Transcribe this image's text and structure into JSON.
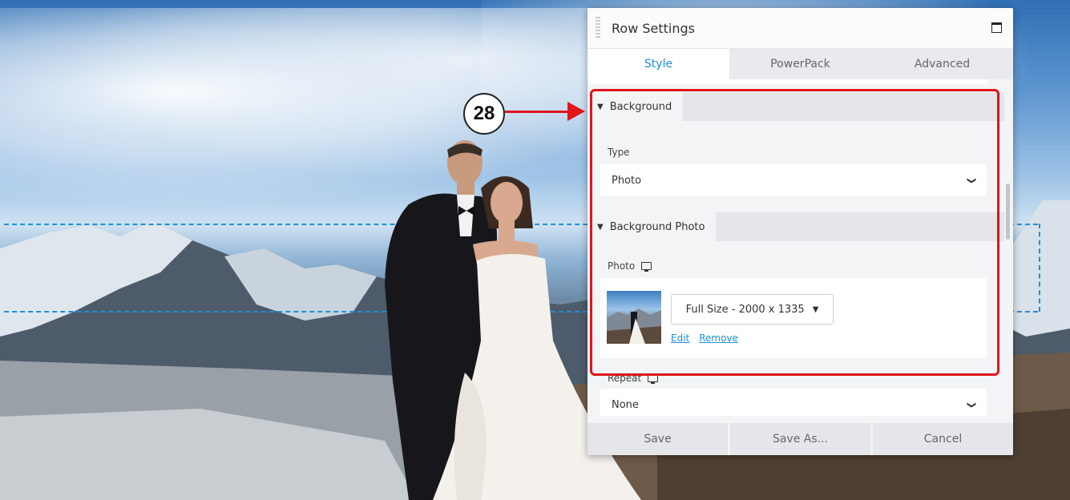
{
  "callout_number": "28",
  "panel": {
    "title": "Row Settings",
    "tabs": [
      {
        "label": "Style",
        "active": true
      },
      {
        "label": "PowerPack",
        "active": false
      },
      {
        "label": "Advanced",
        "active": false
      }
    ],
    "background_section": {
      "label": "Background",
      "type_label": "Type",
      "type_value": "Photo"
    },
    "background_photo_section": {
      "label": "Background Photo",
      "photo_label": "Photo",
      "size_value": "Full Size - 2000 x 1335",
      "edit_link": "Edit",
      "remove_link": "Remove",
      "repeat_label": "Repeat",
      "repeat_value": "None"
    },
    "footer": {
      "save": "Save",
      "save_as": "Save As...",
      "cancel": "Cancel"
    }
  },
  "colors": {
    "accent": "#1e8fd6",
    "highlight": "#e0161b"
  }
}
